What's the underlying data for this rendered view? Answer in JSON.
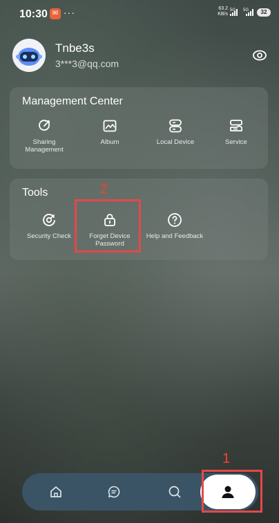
{
  "status_bar": {
    "time": "10:30",
    "more": "···",
    "net_speed_value": "63.2",
    "net_speed_unit": "KB/s",
    "signal_1": "5G",
    "signal_2": "5G",
    "battery": "32"
  },
  "profile": {
    "username": "Tnbe3s",
    "email": "3***3@qq.com"
  },
  "management_center": {
    "title": "Management Center",
    "items": [
      {
        "label": "Sharing Management",
        "icon": "share-icon"
      },
      {
        "label": "Album",
        "icon": "image-icon"
      },
      {
        "label": "Local Device",
        "icon": "device-icon"
      },
      {
        "label": "Service",
        "icon": "service-icon"
      }
    ]
  },
  "tools": {
    "title": "Tools",
    "items": [
      {
        "label": "Security Check",
        "icon": "security-check-icon"
      },
      {
        "label": "Forget Device Password",
        "icon": "lock-icon"
      },
      {
        "label": "Help and Feedback",
        "icon": "help-icon"
      }
    ]
  },
  "annotations": {
    "step_1": "1",
    "step_2": "2",
    "highlight_color": "#e5484a"
  },
  "bottom_nav": {
    "items": [
      "home-icon",
      "chat-icon",
      "search-icon",
      "profile-icon"
    ],
    "active": "profile-icon"
  }
}
